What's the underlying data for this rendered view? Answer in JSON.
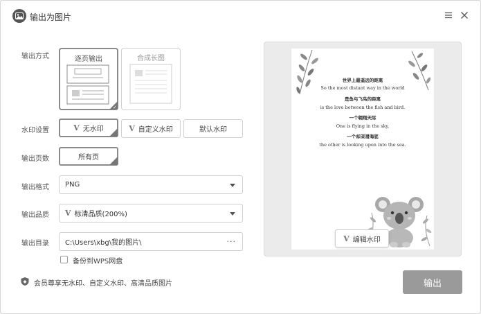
{
  "window": {
    "title": "输出为图片"
  },
  "labels": {
    "output_mode": "输出方式",
    "watermark": "水印设置",
    "pages": "输出页数",
    "format": "输出格式",
    "quality": "输出品质",
    "directory": "输出目录"
  },
  "output_mode": {
    "options": [
      {
        "label": "逐页输出",
        "selected": true
      },
      {
        "label": "合成长图",
        "selected": false
      }
    ]
  },
  "watermark": {
    "options": [
      {
        "label": "无水印",
        "selected": true
      },
      {
        "label": "自定义水印",
        "selected": false
      },
      {
        "label": "默认水印",
        "selected": false
      }
    ]
  },
  "pages": {
    "value": "所有页"
  },
  "format": {
    "value": "PNG"
  },
  "quality": {
    "value": "标清品质(200%)"
  },
  "directory": {
    "value": "C:\\Users\\xbg\\我的图片\\",
    "browse": "···"
  },
  "backup": {
    "label": "备份到WPS网盘",
    "checked": false
  },
  "vip": {
    "text": "会员尊享无水印、自定义水印、高清品质图片"
  },
  "export_button": "输出",
  "preview": {
    "lines": [
      {
        "text": "世界上最遥远的距离",
        "lang": "zh"
      },
      {
        "text": "So the most distant way in the world",
        "lang": "en"
      },
      {
        "text": "是鱼与飞鸟的距离",
        "lang": "zh"
      },
      {
        "text": "is the love between the fish and bird.",
        "lang": "en"
      },
      {
        "text": "一个翱翔天际",
        "lang": "zh"
      },
      {
        "text": "One is flying in the sky,",
        "lang": "en"
      },
      {
        "text": "一个却深潜海底",
        "lang": "zh"
      },
      {
        "text": "the other is looking upon into the sea.",
        "lang": "en"
      }
    ],
    "edit_watermark": "编辑水印"
  },
  "icons": {
    "app": "image-icon",
    "menu": "menu-icon",
    "close": "close-icon",
    "vip": "shield-icon",
    "wps": "wps-v-logo-icon"
  },
  "colors": {
    "accent_border": "#8a8a8a",
    "export_bg": "#9a9a9a"
  }
}
